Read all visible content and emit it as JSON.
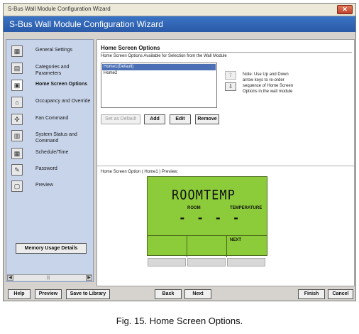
{
  "window": {
    "title": "S-Bus Wall Module Configuration Wizard",
    "close_glyph": "✕"
  },
  "header": {
    "title": "S-Bus Wall Module Configuration Wizard"
  },
  "sidebar": {
    "items": [
      {
        "label": "General Settings",
        "icon": "general-settings-icon",
        "glyph": "▦"
      },
      {
        "label": "Categories and Parameters",
        "icon": "categories-icon",
        "glyph": "▤"
      },
      {
        "label": "Home Screen Options",
        "icon": "home-screen-icon",
        "glyph": "▣"
      },
      {
        "label": "Occupancy and Override",
        "icon": "occupancy-icon",
        "glyph": "⌂"
      },
      {
        "label": "Fan Command",
        "icon": "fan-icon",
        "glyph": "✣"
      },
      {
        "label": "System Status and Command",
        "icon": "system-status-icon",
        "glyph": "▥"
      },
      {
        "label": "Schedule/Time",
        "icon": "schedule-icon",
        "glyph": "▦"
      },
      {
        "label": "Password",
        "icon": "password-icon",
        "glyph": "✎"
      },
      {
        "label": "Preview",
        "icon": "preview-icon",
        "glyph": "▢"
      }
    ],
    "memory_button": "Memory Usage Details",
    "scroll_left": "◀",
    "scroll_right": "▶",
    "scroll_thumb": "|||"
  },
  "main": {
    "title": "Home Screen Options",
    "subtitle": "Home Screen Options Available for Selection from the Wall Module",
    "list": [
      "Home1(Default)",
      "Home2"
    ],
    "up_arrow": "⇧",
    "down_arrow": "⇩",
    "note": "Note: Use Up and Down arrow keys to re-order sequence of Home Screen Options in the wall module",
    "buttons": {
      "set_default": "Set as Default",
      "add": "Add",
      "edit": "Edit",
      "remove": "Remove"
    },
    "preview_label": "Home Screen Option  ( Home1 ) Preview:",
    "lcd": {
      "main_text": "ROOMTEMP",
      "room_label": "ROOM",
      "temp_label": "TEMPERATURE",
      "dashes": "- - - -",
      "next_label": "NEXT"
    }
  },
  "footer": {
    "help": "Help",
    "preview": "Preview",
    "save": "Save to Library",
    "back": "Back",
    "next": "Next",
    "finish": "Finish",
    "cancel": "Cancel"
  },
  "caption": "Fig. 15. Home Screen Options.",
  "colors": {
    "header_blue": "#2a5aa8",
    "sidebar_bg": "#c7d4ea",
    "lcd_green": "#8ccc3a",
    "selection": "#4a6fb5"
  }
}
